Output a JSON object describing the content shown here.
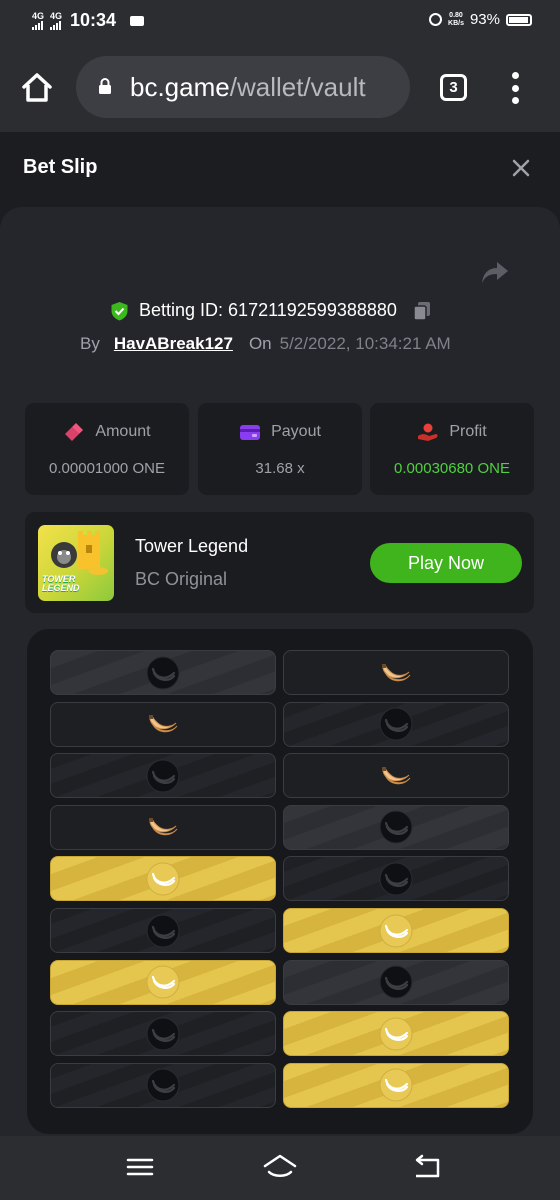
{
  "status_bar": {
    "net1": "4G",
    "net2": "4G",
    "time": "10:34",
    "netspeed_top": "0.80",
    "netspeed_bottom": "KB/s",
    "battery": "93%"
  },
  "browser": {
    "url_domain": "bc.game",
    "url_path": "/wallet/vault",
    "tab_count": "3"
  },
  "modal": {
    "title": "Bet Slip"
  },
  "bet": {
    "betting_id_label": "Betting ID: 617211925993888​80",
    "by_label": "By",
    "username": "HavABreak127",
    "on_label": "On",
    "datetime": "5/2/2022, 10:34:21 AM"
  },
  "stats": {
    "amount_label": "Amount",
    "amount_value": "0.00001000 ONE",
    "payout_label": "Payout",
    "payout_value": "31.68 x",
    "profit_label": "Profit",
    "profit_value": "0.00030680 ONE",
    "profit_color": "#4fd13f"
  },
  "game": {
    "thumb_label_1": "TOWER",
    "thumb_label_2": "LEGEND",
    "name": "Tower Legend",
    "subtitle": "BC Original",
    "play_label": "Play Now",
    "play_color": "#3fb41d"
  },
  "tower_grid": {
    "rows": [
      [
        {
          "style": "grey",
          "icon": "dark-banana"
        },
        {
          "style": "plain",
          "icon": "banana"
        }
      ],
      [
        {
          "style": "plain",
          "icon": "banana"
        },
        {
          "style": "dark",
          "icon": "dark-banana"
        }
      ],
      [
        {
          "style": "dark",
          "icon": "dark-banana"
        },
        {
          "style": "plain",
          "icon": "banana"
        }
      ],
      [
        {
          "style": "plain",
          "icon": "banana"
        },
        {
          "style": "grey",
          "icon": "dark-banana"
        }
      ],
      [
        {
          "style": "gold",
          "icon": "gold-banana"
        },
        {
          "style": "dark",
          "icon": "dark-banana"
        }
      ],
      [
        {
          "style": "dark",
          "icon": "dark-banana"
        },
        {
          "style": "gold",
          "icon": "gold-banana"
        }
      ],
      [
        {
          "style": "gold",
          "icon": "gold-banana"
        },
        {
          "style": "grey",
          "icon": "dark-banana"
        }
      ],
      [
        {
          "style": "dark",
          "icon": "dark-banana"
        },
        {
          "style": "gold",
          "icon": "gold-banana"
        }
      ],
      [
        {
          "style": "dark",
          "icon": "dark-banana"
        },
        {
          "style": "gold",
          "icon": "gold-banana"
        }
      ]
    ]
  },
  "nav": {
    "items": [
      "menu-icon",
      "home-icon",
      "back-icon"
    ]
  }
}
